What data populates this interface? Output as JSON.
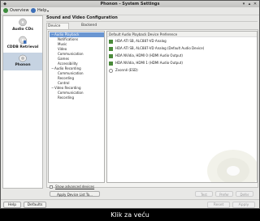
{
  "window": {
    "title": "Phonon - System Settings"
  },
  "menu": {
    "overview": "Overview",
    "help": "Help"
  },
  "sidebar": {
    "items": [
      {
        "label": "Audio CDs"
      },
      {
        "label": "CDDB Retrieval"
      },
      {
        "label": "Phonon"
      }
    ]
  },
  "section_title": "Sound and Video Configuration",
  "tabs": {
    "device": "Device Preference",
    "backend": "Backend"
  },
  "tree": [
    {
      "label": "Audio Playback",
      "indent": 0,
      "toggle": "−"
    },
    {
      "label": "Notifications",
      "indent": 1
    },
    {
      "label": "Music",
      "indent": 1
    },
    {
      "label": "Video",
      "indent": 1
    },
    {
      "label": "Communication",
      "indent": 1
    },
    {
      "label": "Games",
      "indent": 1
    },
    {
      "label": "Accessibility",
      "indent": 1
    },
    {
      "label": "Audio Recording",
      "indent": 0,
      "toggle": "−"
    },
    {
      "label": "Communication",
      "indent": 1
    },
    {
      "label": "Recording",
      "indent": 1
    },
    {
      "label": "Control",
      "indent": 1
    },
    {
      "label": "Video Recording",
      "indent": 0,
      "toggle": "−"
    },
    {
      "label": "Communication",
      "indent": 1
    },
    {
      "label": "Recording",
      "indent": 1
    }
  ],
  "devices": {
    "header": "Default Audio Playback Device Preference",
    "items": [
      "HDA ATI SB, ALC887-VD Analog",
      "HDA ATI SB, ALC887-VD Analog (Default Audio Device)",
      "HDA NVidia, HDMI 0 (HDMI Audio Output)",
      "HDA NVidia, HDMI 1 (HDMI Audio Output)",
      "Zvonně (ESD)"
    ]
  },
  "show_advanced": "Show advanced devices",
  "apply_list": "Apply Device List To...",
  "small_buttons": [
    "Test",
    "Prefer",
    "Defer"
  ],
  "bottom": {
    "help": "Help",
    "defaults": "Defaults",
    "reset": "Reset",
    "apply": "Apply"
  },
  "caption": "Klik za veću",
  "colors": {
    "selection": "#6a96d2",
    "sidebar_active": "#c6d3e2",
    "device_icon": "#4a8a3a"
  }
}
